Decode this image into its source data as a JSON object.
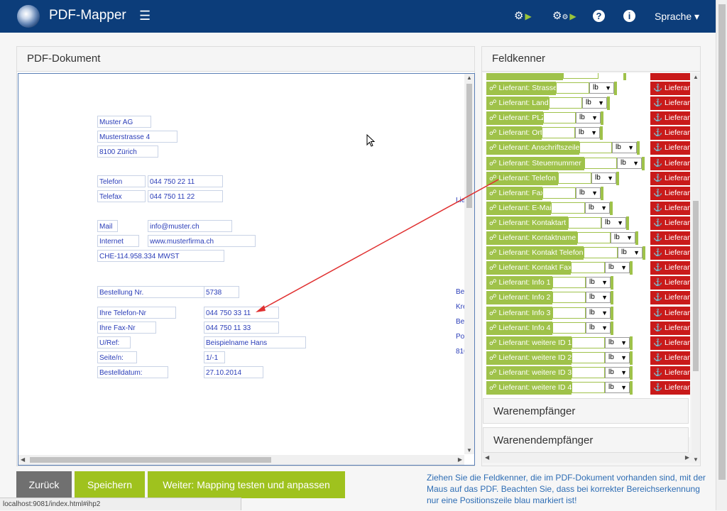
{
  "app": {
    "title": "PDF-Mapper",
    "menu_label": "Sprache ▾"
  },
  "pdf_panel": {
    "title": "PDF-Dokument"
  },
  "pdf_fields": [
    "Muster AG",
    "Musterstrasse 4",
    "8100 Zürich",
    "Telefon",
    "044 750 22 11",
    "Telefax",
    "044 750 11 22",
    "Mail",
    "info@muster.ch",
    "Internet",
    "www.musterfirma.ch",
    "CHE-114.958.334 MWST",
    "Bestellung Nr.",
    "5738",
    "Ihre Telefon-Nr",
    "044 750 33 11",
    "Ihre Fax-Nr",
    "044 750 11 33",
    "U/Ref:",
    "Beispielname Hans",
    "Seite/n:",
    "1/-1",
    "Bestelldatum:",
    "27.10.2014",
    "Lie",
    "Be",
    "Kre",
    "Be",
    "Po",
    "810"
  ],
  "feld_panel": {
    "title": "Feldkenner"
  },
  "feld_items": [
    {
      "label": "Lieferant: Strasse",
      "select": "lb",
      "action": "Lieferan"
    },
    {
      "label": "Lieferant: Land",
      "select": "lb",
      "action": "Lieferan"
    },
    {
      "label": "Lieferant: PLZ",
      "select": "lb",
      "action": "Lieferan"
    },
    {
      "label": "Lieferant: Ort",
      "select": "lb",
      "action": "Lieferan"
    },
    {
      "label": "Lieferant: Anschriftszeile",
      "select": "lb",
      "action": "Lieferan"
    },
    {
      "label": "Lieferant: Steuernummer",
      "select": "lb",
      "action": "Lieferan"
    },
    {
      "label": "Lieferant: Telefon",
      "select": "lb",
      "action": "Lieferan"
    },
    {
      "label": "Lieferant: Fax",
      "select": "lb",
      "action": "Lieferan"
    },
    {
      "label": "Lieferant: E-Mail",
      "select": "lb",
      "action": "Lieferan"
    },
    {
      "label": "Lieferant: Kontaktart",
      "select": "lb",
      "action": "Lieferan"
    },
    {
      "label": "Lieferant: Kontaktname",
      "select": "lb",
      "action": "Lieferan"
    },
    {
      "label": "Lieferant: Kontakt Telefon",
      "select": "lb",
      "action": "Lieferan"
    },
    {
      "label": "Lieferant: Kontakt Fax",
      "select": "lb",
      "action": "Lieferan"
    },
    {
      "label": "Lieferant: Info 1",
      "select": "lb",
      "action": "Lieferan"
    },
    {
      "label": "Lieferant: Info 2",
      "select": "lb",
      "action": "Lieferan"
    },
    {
      "label": "Lieferant: Info 3",
      "select": "lb",
      "action": "Lieferan"
    },
    {
      "label": "Lieferant: Info 4",
      "select": "lb",
      "action": "Lieferan"
    },
    {
      "label": "Lieferant: weitere ID 1",
      "select": "lb",
      "action": "Lieferan"
    },
    {
      "label": "Lieferant: weitere ID 2",
      "select": "lb",
      "action": "Lieferan"
    },
    {
      "label": "Lieferant: weitere ID 3",
      "select": "lb",
      "action": "Lieferan"
    },
    {
      "label": "Lieferant: weitere ID 4",
      "select": "lb",
      "action": "Lieferan"
    }
  ],
  "accordion": {
    "warenempfaenger": "Warenempfänger",
    "warenendempfaenger": "Warenendempfänger"
  },
  "buttons": {
    "back": "Zurück",
    "save": "Speichern",
    "next": "Weiter: Mapping testen und anpassen"
  },
  "hint": "Ziehen Sie die Feldkenner, die im PDF-Dokument vorhanden sind, mit der Maus auf das PDF. Beachten Sie, dass bei korrekter Bereichserkennung nur eine Positionszeile blau markiert ist!",
  "status_url": "localhost:9081/index.html#ihp2",
  "colors": {
    "nav": "#0c3d7a",
    "green": "#9fc24a",
    "red": "#c91a1a",
    "pdf_text": "#2a3db8"
  }
}
